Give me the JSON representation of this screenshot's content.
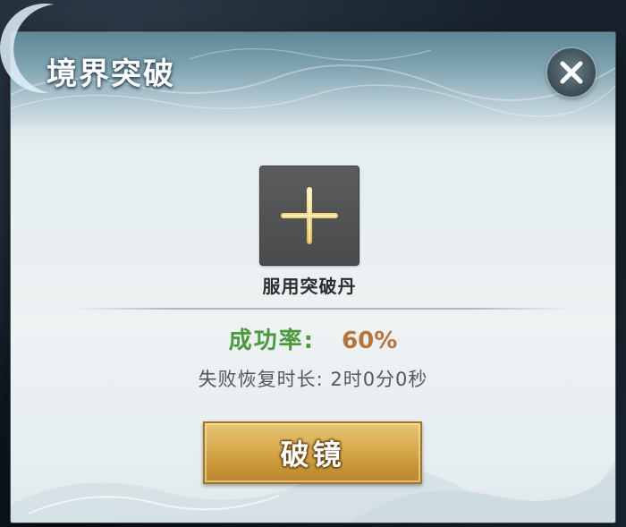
{
  "dialog": {
    "title": "境界突破",
    "close_icon": "close-icon"
  },
  "slot": {
    "icon": "plus-icon",
    "label": "服用突破丹"
  },
  "stats": {
    "success_label": "成功率:",
    "success_value": "60%",
    "recover_text": "失败恢复时长: 2时0分0秒"
  },
  "actions": {
    "break_label": "破镜"
  },
  "colors": {
    "success_green": "#4c9a3b",
    "rate_orange": "#b9743a",
    "button_gold": "#d8ad50",
    "slot_gray": "#4a4b4c"
  }
}
